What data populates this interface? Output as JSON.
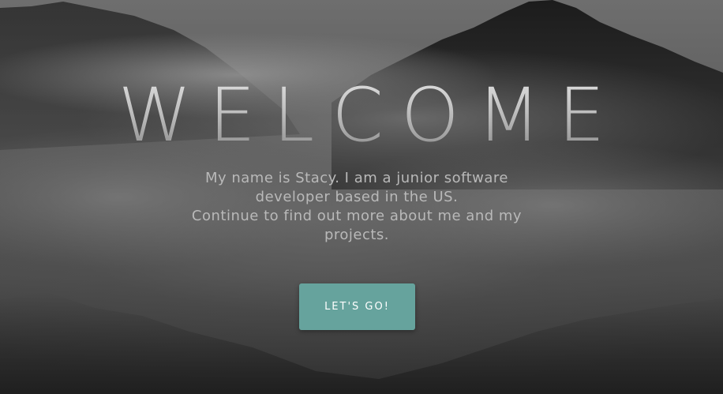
{
  "hero": {
    "title": "WELCOME",
    "intro_line1": "My name is Stacy. I am a junior software developer based in the US.",
    "intro_line2": "Continue to find out more about me and my projects.",
    "cta_label": "LET'S GO!"
  },
  "colors": {
    "accent": "#66a39d",
    "background": "#4b4b4b",
    "text": "#b9b9b9"
  }
}
